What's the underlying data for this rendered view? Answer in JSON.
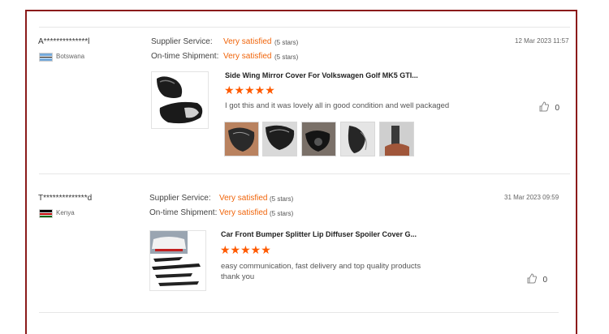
{
  "reviews": [
    {
      "user": "A**************l",
      "country": "Botswana",
      "supplier_label": "Supplier Service:",
      "supplier_value": "Very satisfied",
      "supplier_stars": "(5 stars)",
      "shipment_label": "On-time Shipment:",
      "shipment_value": "Very satisfied",
      "shipment_stars": "(5 stars)",
      "date": "12 Mar 2023 11:57",
      "product_title": "Side Wing Mirror Cover For Volkswagen Golf MK5 GTI...",
      "rating": 5,
      "stars": "★★★★★",
      "text": "I got this and it was lovely all in good condition and well packaged",
      "likes": "0"
    },
    {
      "user": "T**************d",
      "country": "Kenya",
      "supplier_label": "Supplier Service:",
      "supplier_value": "Very satisfied",
      "supplier_stars": "(5 stars)",
      "shipment_label": "On-time Shipment:",
      "shipment_value": "Very satisfied",
      "shipment_stars": "(5 stars)",
      "date": "31 Mar 2023 09:59",
      "product_title": "Car Front Bumper Splitter Lip Diffuser Spoiler Cover G...",
      "rating": 5,
      "stars": "★★★★★",
      "text": "easy communication, fast delivery and top quality products thank you",
      "likes": "0"
    }
  ],
  "icons": {
    "like": "thumbs-up-icon",
    "flag_botswana": "botswana-flag-icon",
    "flag_kenya": "kenya-flag-icon"
  },
  "colors": {
    "accent": "#f0640a",
    "star": "#ff5a00",
    "frame": "#8b1a1a"
  }
}
